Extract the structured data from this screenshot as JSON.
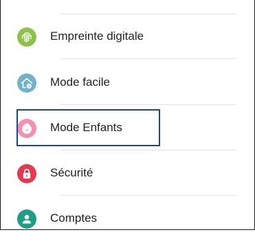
{
  "settings_list": {
    "items": [
      {
        "label": "Empreinte digitale",
        "icon": "fingerprint-icon",
        "icon_color": "#8bc34a"
      },
      {
        "label": "Mode facile",
        "icon": "easy-mode-home-icon",
        "icon_color": "#6fb3c8"
      },
      {
        "label": "Mode Enfants",
        "icon": "kids-face-icon",
        "icon_color": "#f48fb1",
        "focused": true
      },
      {
        "label": "Sécurité",
        "icon": "lock-icon",
        "icon_color": "#e63950"
      },
      {
        "label": "Comptes",
        "icon": "account-icon",
        "icon_color": "#1e9e86"
      }
    ]
  }
}
